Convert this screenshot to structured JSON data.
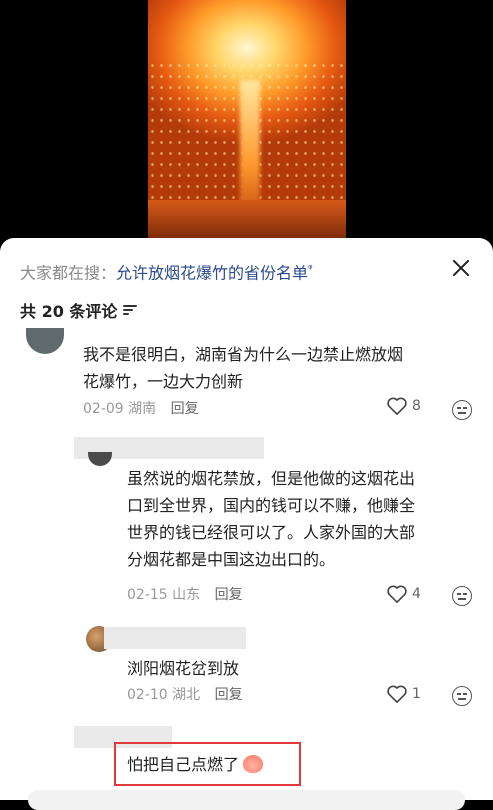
{
  "search": {
    "prefix": "大家都在搜：",
    "query": "允许放烟花爆竹的省份名单",
    "glyph": "ᵠ"
  },
  "comments_header": {
    "label": "共 20 条评论"
  },
  "comments": [
    {
      "line1": "我不是很明白，湖南省为什么一边禁止燃放烟",
      "line2": "花爆竹，一边大力创新",
      "date": "02-09",
      "location": "湖南",
      "reply": "回复",
      "likes": "8"
    },
    {
      "line1": "虽然说的烟花禁放，但是他做的这烟花出",
      "line2": "口到全世界，国内的钱可以不赚，他赚全",
      "line3": "世界的钱已经很可以了。人家外国的大部",
      "line4": "分烟花都是中国这边出口的。",
      "date": "02-15",
      "location": "山东",
      "reply": "回复",
      "likes": "4"
    },
    {
      "line1": "浏阳烟花岔到放",
      "date": "02-10",
      "location": "湖北",
      "reply": "回复",
      "likes": "1"
    },
    {
      "line1": "怕把自己点燃了"
    }
  ],
  "colors": {
    "link": "#2b4b8f",
    "highlight": "#e03a3a"
  }
}
